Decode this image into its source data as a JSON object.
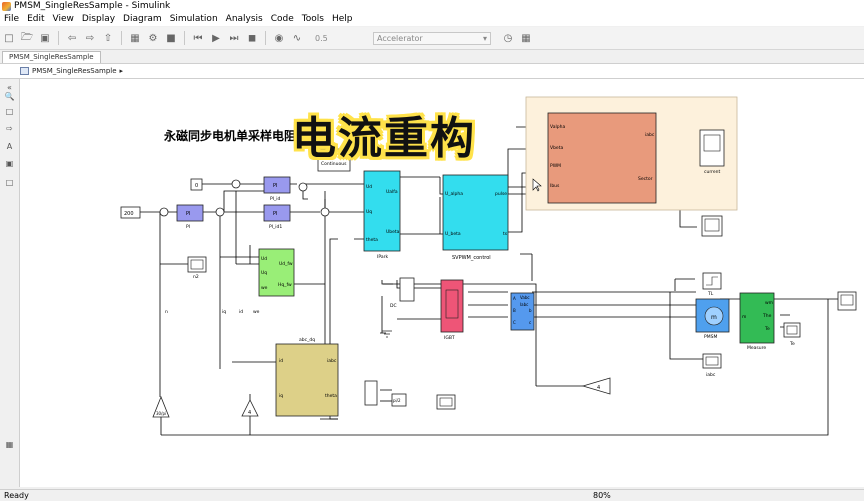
{
  "window": {
    "title": "PMSM_SingleResSample - Simulink"
  },
  "menu": [
    "File",
    "Edit",
    "View",
    "Display",
    "Diagram",
    "Simulation",
    "Analysis",
    "Code",
    "Tools",
    "Help"
  ],
  "toolbar": {
    "stop_time": "0.5",
    "sim_mode": "Accelerator"
  },
  "tab": {
    "label": "PMSM_SingleResSample"
  },
  "breadcrumb": {
    "label": "PMSM_SingleResSample"
  },
  "overlay": {
    "title": "电流重构"
  },
  "diagram": {
    "title": "永磁同步电机单采样电阻",
    "title_hidden_char": "模",
    "title_tail_char": "B",
    "powergui": "Continuous",
    "const_200": "200",
    "const_0": "0",
    "pi_labels": {
      "pi": "PI",
      "pi_iq": "PI_iq",
      "pi_id": "PI_id",
      "pi_id1": "PI_id1"
    },
    "ipark": {
      "name": "IPark",
      "in_ud": "Ud",
      "in_uq": "Uq",
      "in_theta": "theta",
      "out_ualfa": "Ualfa",
      "out_ubeta": "Ubeta"
    },
    "svpwm": {
      "name": "SVPWM_control",
      "in_ualpha": "U_alpha",
      "in_ubeta": "U_beta",
      "out_pulse": "pulse",
      "out_ts": "ts"
    },
    "recon": {
      "in_valpha": "Valpha",
      "in_vbeta": "Vbeta",
      "in_pwm": "PWM",
      "in_ibus": "Ibus",
      "out_iabc": "iabc",
      "out_sector": "Sector"
    },
    "scopes": {
      "current": "current",
      "n2": "n2",
      "iabc": "iabc",
      "te": "Te"
    },
    "decoupling": {
      "in_ud": "Ud",
      "in_uq": "Uq",
      "in_we": "we",
      "out_ud_fe": "Ud_fw",
      "out_uq_fe": "Hq_fw"
    },
    "signals": {
      "n": "n",
      "id": "id",
      "iq": "iq",
      "we": "we"
    },
    "abc_dq": {
      "name": "abc_dq",
      "in_iabc": "iabc",
      "in_theta": "theta",
      "out_id": "id",
      "out_iq": "iq"
    },
    "dc": {
      "name": "DC"
    },
    "igbt": {
      "name": "IGBT"
    },
    "pmsm": {
      "name": "PMSM",
      "in_tl": "TL",
      "in_a": "A",
      "in_b": "B",
      "in_c": "C",
      "out_m": "m"
    },
    "measure": {
      "name": "Measure",
      "out_wm": "wm",
      "out_the": "The",
      "out_te": "Te",
      "in_m": "m"
    },
    "voltage": {
      "in_vabc": "Vabc",
      "in_iabc": "Iabc",
      "in_a": "A",
      "in_b": "B",
      "in_c": "C",
      "out_a": "a",
      "out_b": "b",
      "out_c": "c"
    },
    "tl_step": "TL",
    "gain_4": "4",
    "gain_30pi": "30/pi",
    "gain_pi2": "pi/2"
  },
  "status": {
    "state": "Ready",
    "zoom": "80%"
  }
}
